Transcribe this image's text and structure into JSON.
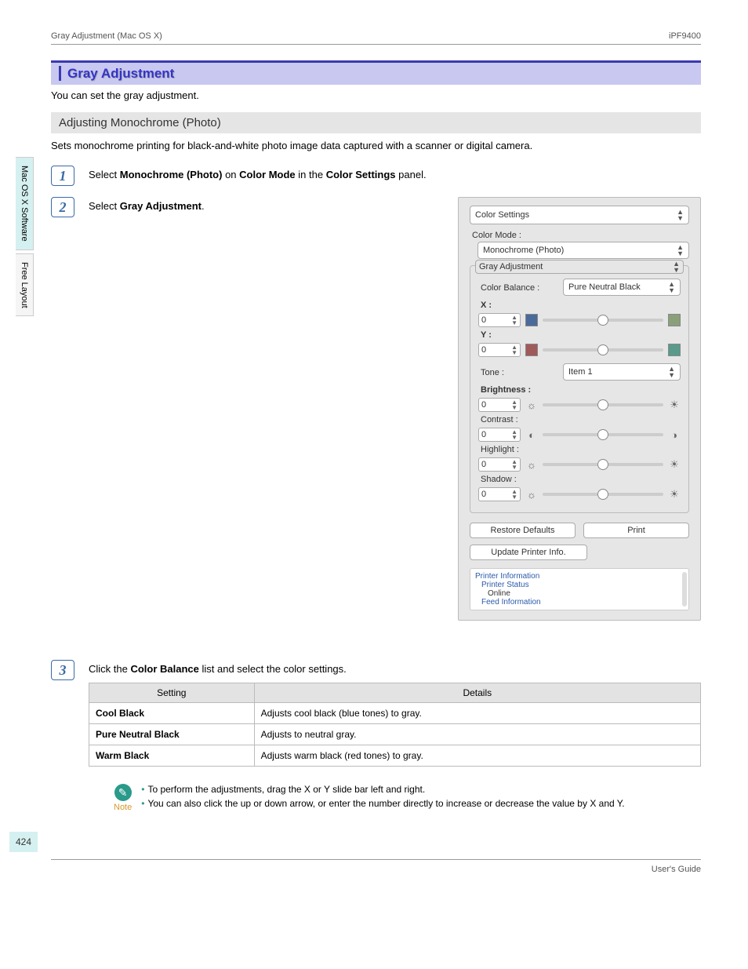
{
  "header": {
    "left": "Gray Adjustment (Mac OS X)",
    "right": "iPF9400"
  },
  "side": {
    "tab1": "Mac OS X Software",
    "tab2": "Free Layout"
  },
  "section": {
    "title": "Gray Adjustment",
    "intro": "You can set the gray adjustment."
  },
  "sub": {
    "title": "Adjusting Monochrome (Photo)",
    "desc": "Sets monochrome printing for black-and-white photo image data captured with a scanner or digital camera."
  },
  "steps": {
    "s1": {
      "num": "1",
      "pre": "Select ",
      "b1": "Monochrome (Photo)",
      "mid1": " on ",
      "b2": "Color Mode",
      "mid2": " in the ",
      "b3": "Color Settings",
      "post": " panel."
    },
    "s2": {
      "num": "2",
      "pre": "Select ",
      "b1": "Gray Adjustment",
      "post": "."
    },
    "s3": {
      "num": "3",
      "pre": "Click the ",
      "b1": "Color Balance",
      "post": " list and select the color settings."
    }
  },
  "panel": {
    "top": "Color Settings",
    "colorModeLbl": "Color Mode :",
    "colorMode": "Monochrome (Photo)",
    "grayAdj": "Gray Adjustment",
    "cbLbl": "Color Balance :",
    "cbVal": "Pure Neutral Black",
    "x": "X :",
    "y": "Y :",
    "zero": "0",
    "toneLbl": "Tone :",
    "toneVal": "Item 1",
    "brightness": "Brightness :",
    "contrast": "Contrast :",
    "highlight": "Highlight :",
    "shadow": "Shadow :",
    "restore": "Restore Defaults",
    "print": "Print",
    "update": "Update Printer Info.",
    "pinfo": "Printer Information",
    "pstatus": "Printer Status",
    "online": "Online",
    "feed": "Feed Information"
  },
  "table": {
    "h1": "Setting",
    "h2": "Details",
    "r1k": "Cool Black",
    "r1v": "Adjusts cool black (blue tones) to gray.",
    "r2k": "Pure Neutral Black",
    "r2v": "Adjusts to neutral gray.",
    "r3k": "Warm Black",
    "r3v": "Adjusts warm black (red tones) to gray."
  },
  "note": {
    "word": "Note",
    "l1": "To perform the adjustments, drag the X or Y slide bar left and right.",
    "l2": "You can also click the up or down arrow, or enter the number directly to increase or decrease the value by X and Y."
  },
  "pageNum": "424",
  "footer": "User's Guide"
}
